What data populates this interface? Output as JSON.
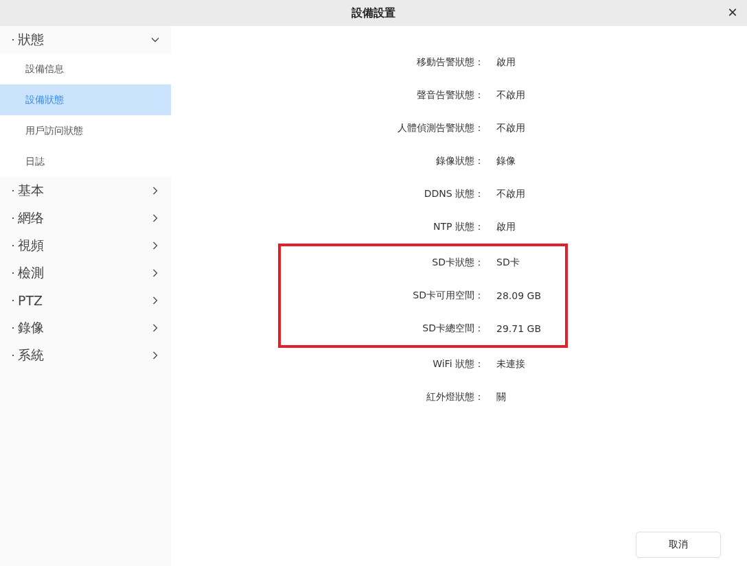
{
  "window": {
    "title": "設備設置",
    "close": "×"
  },
  "sidebar": {
    "groups": [
      {
        "label": "狀態",
        "expanded": true,
        "children": [
          {
            "label": "設備信息",
            "selected": false
          },
          {
            "label": "設備狀態",
            "selected": true
          },
          {
            "label": "用戶訪问狀態",
            "selected": false
          },
          {
            "label": "日誌",
            "selected": false
          }
        ]
      },
      {
        "label": "基本",
        "expanded": false
      },
      {
        "label": "網络",
        "expanded": false
      },
      {
        "label": "視頻",
        "expanded": false
      },
      {
        "label": "檢測",
        "expanded": false
      },
      {
        "label": "PTZ",
        "expanded": false
      },
      {
        "label": "錄像",
        "expanded": false
      },
      {
        "label": "系統",
        "expanded": false
      }
    ]
  },
  "status_groups": [
    {
      "highlighted": false,
      "rows": [
        {
          "label": "移動告警狀態：",
          "value": "啟用"
        },
        {
          "label": "聲音告警狀態：",
          "value": "不啟用"
        },
        {
          "label": "人體偵測告警狀態：",
          "value": "不啟用"
        },
        {
          "label": "錄像狀態：",
          "value": "錄像"
        },
        {
          "label": "DDNS 狀態：",
          "value": "不啟用"
        },
        {
          "label": "NTP 狀態：",
          "value": "啟用"
        }
      ]
    },
    {
      "highlighted": true,
      "rows": [
        {
          "label": "SD卡狀態：",
          "value": "SD卡"
        },
        {
          "label": "SD卡可用空間：",
          "value": "28.09 GB"
        },
        {
          "label": "SD卡總空間：",
          "value": "29.71 GB"
        }
      ]
    },
    {
      "highlighted": false,
      "rows": [
        {
          "label": "WiFi 狀態：",
          "value": "未連接"
        },
        {
          "label": "紅外燈狀態：",
          "value": "關"
        }
      ]
    }
  ],
  "buttons": [
    {
      "label": "取消"
    }
  ]
}
